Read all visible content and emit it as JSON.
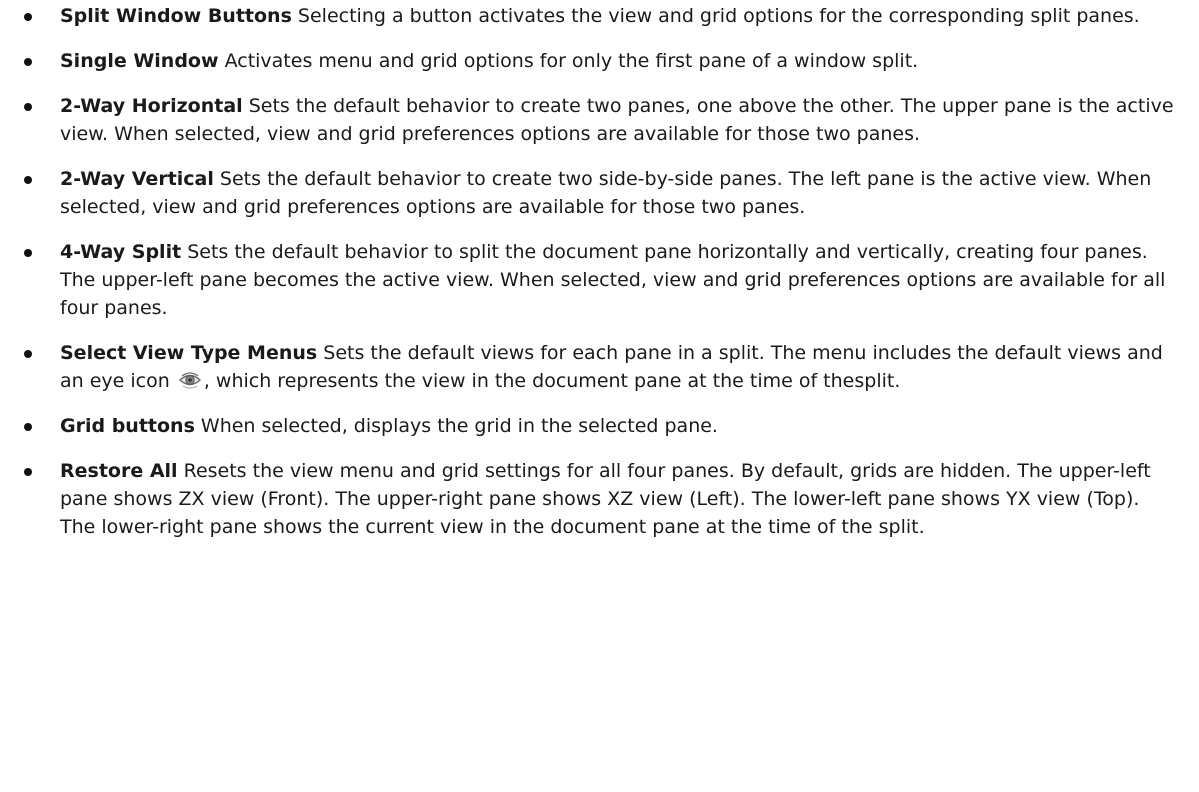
{
  "items": [
    {
      "term": "Split Window Buttons",
      "text": " Selecting a button activates the view and grid options for the corresponding split panes."
    },
    {
      "term": "Single Window",
      "text": " Activates menu and grid options for only the first pane of a window split."
    },
    {
      "term": "2-Way Horizontal",
      "text": " Sets the default behavior to create two panes, one above the other. The upper pane is the active view. When selected, view and grid preferences options are available for those two panes."
    },
    {
      "term": "2-Way Vertical",
      "text": " Sets the default behavior to create two side-by-side panes. The left pane is the active view. When selected, view and grid preferences options are available for those two panes."
    },
    {
      "term": "4-Way Split",
      "text": " Sets the default behavior to split the document pane horizontally and vertically, creating four panes. The upper-left pane becomes the active view. When selected, view and grid preferences options are available for all four panes."
    },
    {
      "term": "Select View Type Menus",
      "text_before_icon": " Sets the default views for each pane in a split. The menu includes the default views and an eye icon ",
      "icon": "eye-icon",
      "text_after_icon": ", which represents the view in the document pane at the time of thesplit."
    },
    {
      "term": "Grid buttons",
      "text": " When selected, displays the grid in the selected pane."
    },
    {
      "term": "Restore All",
      "text": " Resets the view menu and grid settings for all four panes. By default, grids are hidden. The upper-left pane shows ZX view (Front). The upper-right pane shows XZ view (Left). The lower-left pane shows YX view (Top). The lower-right pane shows the current view in the document pane at the time of the split."
    }
  ]
}
